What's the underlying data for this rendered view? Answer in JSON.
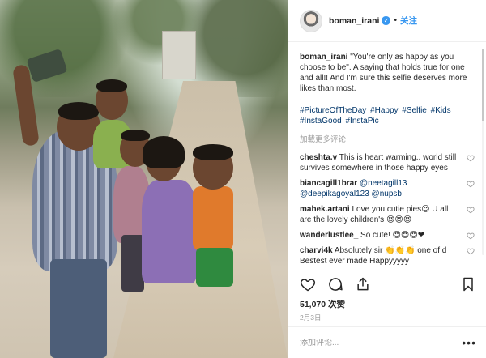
{
  "post": {
    "username": "boman_irani",
    "verified_mark": "✓",
    "separator": "•",
    "follow_label": "关注",
    "caption_user": "boman_irani",
    "caption_text": " \"You're only as happy as you choose to be\". A saying that holds true for one and all!! And I'm sure this selfie deserves more likes than most.",
    "caption_dot": ".",
    "hashtags": [
      "#PictureOfTheDay",
      "#Happy",
      "#Selfie",
      "#Kids",
      "#InstaGood",
      "#InstaPic"
    ],
    "load_more": "加载更多评论",
    "comments": [
      {
        "user": "cheshta.v",
        "text": " This is heart warming.. world still survives somewhere in those happy eyes"
      },
      {
        "user": "biancagill1brar",
        "text": " @neetagill13 @deepikagoyal123 @nupsb"
      },
      {
        "user": "mahek.artani",
        "text": " Love you cutie pies😍 U all are the lovely children's 😍😍😍"
      },
      {
        "user": "wanderlustlee_",
        "text": " So cute! 😍😍😍❤"
      },
      {
        "user": "charvi4k",
        "text": " Absolutely sir 👏👏👏 one of d Bestest ever made Happyyyyy"
      }
    ],
    "likes": "51,070 次赞",
    "date": "2月3日",
    "comment_placeholder": "添加评论...",
    "more_options": "•••"
  },
  "icons": {
    "like": "heart-icon",
    "comment": "comment-icon",
    "share": "share-icon",
    "save": "bookmark-icon"
  },
  "colors": {
    "accent": "#3897f0",
    "hashtag": "#003569",
    "muted": "#999999",
    "text": "#262626"
  }
}
